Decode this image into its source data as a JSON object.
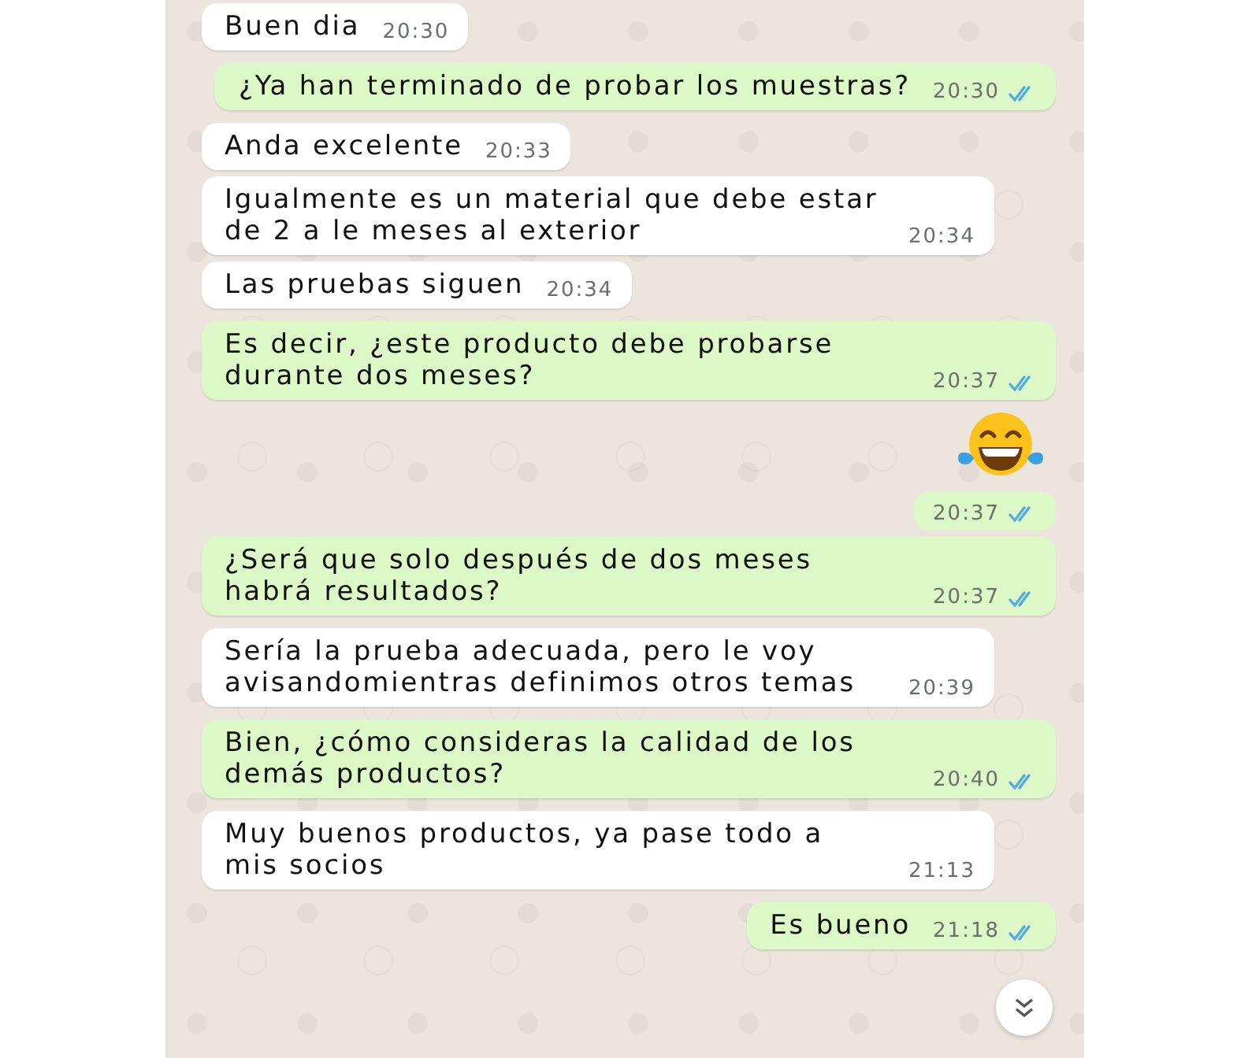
{
  "messages": [
    {
      "kind": "in",
      "text": "Buen dia",
      "time": "20:30"
    },
    {
      "kind": "out",
      "text": "¿Ya han terminado de probar los muestras?",
      "time": "20:30",
      "read": true
    },
    {
      "kind": "in",
      "text": "Anda excelente",
      "time": "20:33"
    },
    {
      "kind": "in",
      "text": "Igualmente es un material que debe estar de 2 a le meses al exterior",
      "time": "20:34"
    },
    {
      "kind": "in",
      "text": "Las pruebas siguen",
      "time": "20:34"
    },
    {
      "kind": "out",
      "text": "Es decir, ¿este producto debe probarse durante dos meses?",
      "time": "20:37",
      "read": true
    },
    {
      "kind": "emoji",
      "time": "20:37",
      "read": true
    },
    {
      "kind": "out",
      "text": "¿Será que solo después de dos meses habrá resultados?",
      "time": "20:37",
      "read": true
    },
    {
      "kind": "in",
      "text": "Sería la prueba adecuada,  pero le voy avisandomientras definimos otros temas",
      "time": "20:39"
    },
    {
      "kind": "out",
      "text": "Bien, ¿cómo consideras la calidad de los demás productos?",
      "time": "20:40",
      "read": true
    },
    {
      "kind": "in",
      "text": "Muy buenos productos,  ya pase todo a mis socios",
      "time": "21:13"
    },
    {
      "kind": "out",
      "text": "Es bueno",
      "time": "21:18",
      "read": true
    }
  ]
}
